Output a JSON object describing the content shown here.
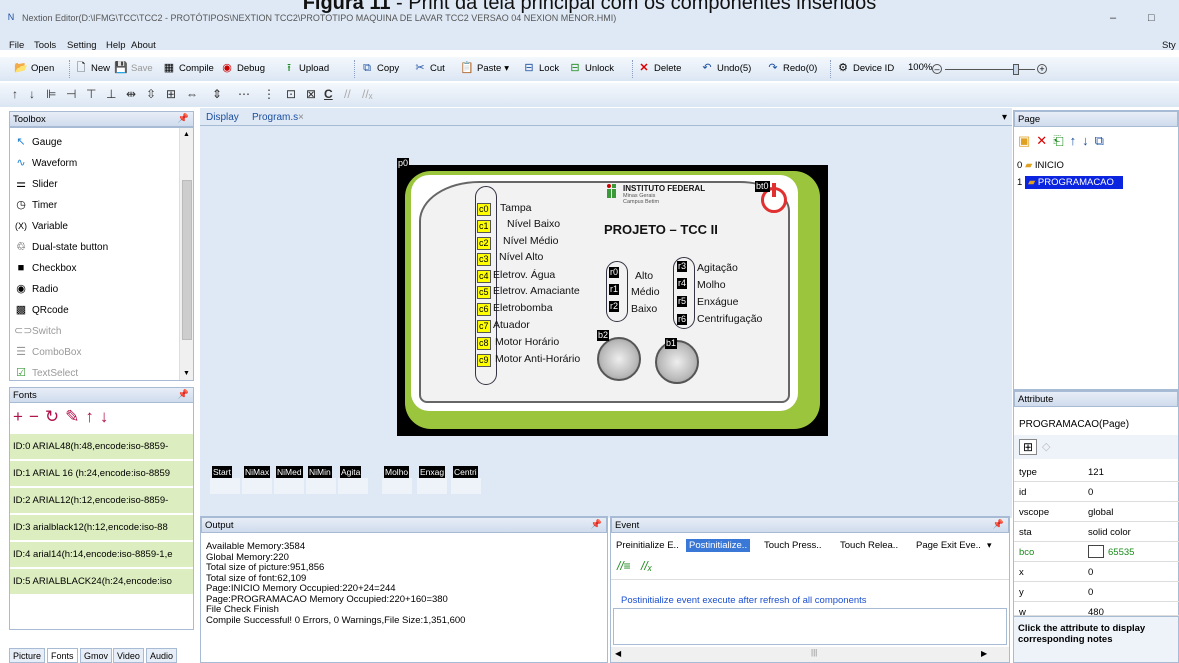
{
  "caption": {
    "prefix": "Figura 11",
    "text": " - Print da tela principal com os componentes inseridos"
  },
  "window": {
    "title": "Nextion Editor(D:\\IFMG\\TCC\\TCC2 - PROTÓTIPOS\\NEXTION TCC2\\PROTOTIPO MAQUINA DE LAVAR TCC2 VERSAO 04 NEXION MENOR.HMI)",
    "minimize": "–",
    "maximize": "□"
  },
  "menu": [
    "File",
    "Tools",
    "Setting",
    "Help",
    "About"
  ],
  "menu_right": "Sty",
  "toolbar": {
    "open": "Open",
    "new": "New",
    "save": "Save",
    "compile": "Compile",
    "debug": "Debug",
    "upload": "Upload",
    "copy": "Copy",
    "cut": "Cut",
    "paste": "Paste",
    "lock": "Lock",
    "unlock": "Unlock",
    "delete": "Delete",
    "undo": "Undo(5)",
    "redo": "Redo(0)",
    "device_id": "Device ID",
    "zoom": "100%"
  },
  "toolbox": {
    "title": "Toolbox",
    "items": [
      "Gauge",
      "Waveform",
      "Slider",
      "Timer",
      "Variable",
      "Dual-state button",
      "Checkbox",
      "Radio",
      "QRcode",
      "Switch",
      "ComboBox",
      "TextSelect"
    ]
  },
  "fonts": {
    "title": "Fonts",
    "rows": [
      "ID:0  ARIAL48(h:48,encode:iso-8859-",
      "ID:1  ARIAL 16 (h:24,encode:iso-8859",
      "ID:2  ARIAL12(h:12,encode:iso-8859-",
      "ID:3  arialblack12(h:12,encode:iso-88",
      "ID:4  arial14(h:14,encode:iso-8859-1,e",
      "ID:5  ARIALBLACK24(h:24,encode:iso"
    ]
  },
  "bottom_tabs": [
    "Picture",
    "Fonts",
    "Gmov",
    "Video",
    "Audio"
  ],
  "doc_tabs": [
    "Display",
    "Program.s"
  ],
  "device": {
    "page_tag": "p0",
    "brand": "INSTITUTO FEDERAL",
    "brand_sub1": "Minas Gerais",
    "brand_sub2": "Campus Betim",
    "project": "PROJETO – TCC II",
    "left_labels": [
      "Tampa",
      "Nível Baixo",
      "Nível Médio",
      "Nível Alto",
      "Eletrov. Água",
      "Eletrov. Amaciante",
      "Eletrobomba",
      "Atuador",
      "Motor Horário",
      "Motor Anti-Horário"
    ],
    "left_tags": [
      "c0",
      "c1",
      "c2",
      "c3",
      "c4",
      "c5",
      "c6",
      "c7",
      "c8",
      "c9"
    ],
    "level_labels": [
      "Alto",
      "Médio",
      "Baixo"
    ],
    "level_tags": [
      "r0",
      "r1",
      "r2"
    ],
    "mode_labels": [
      "Agitação",
      "Molho",
      "Enxágue",
      "Centrifugação"
    ],
    "mode_tags": [
      "r3",
      "r4",
      "r5",
      "r6"
    ],
    "knob_tags": [
      "b2",
      "b1"
    ],
    "power_tag": "bt0"
  },
  "strip": [
    "Start",
    "NiMax",
    "NiMed",
    "NiMin",
    "Agita",
    "Molho",
    "Enxag",
    "Centri"
  ],
  "output": {
    "title": "Output",
    "lines": [
      "Available Memory:3584",
      "Global Memory:220",
      "Total size of picture:951,856",
      "Total size of font:62,109",
      "Page:INICIO Memory Occupied:220+24=244",
      "Page:PROGRAMACAO Memory Occupied:220+160=380",
      "File Check Finish",
      "Compile Successful! 0 Errors, 0 Warnings,File Size:1,351,600"
    ]
  },
  "event": {
    "title": "Event",
    "tabs": [
      "Preinitialize E..",
      "Postinitialize..",
      "Touch Press..",
      "Touch Relea..",
      "Page Exit Eve.."
    ],
    "desc": "Postinitialize event execute after refresh of all components"
  },
  "page": {
    "title": "Page",
    "items": [
      {
        "idx": "0",
        "name": "INICIO"
      },
      {
        "idx": "1",
        "name": "PROGRAMACAO"
      }
    ]
  },
  "attribute": {
    "title": "Attribute",
    "object": "PROGRAMACAO(Page)",
    "rows": [
      {
        "k": "type",
        "v": "121"
      },
      {
        "k": "id",
        "v": "0"
      },
      {
        "k": "vscope",
        "v": "global"
      },
      {
        "k": "sta",
        "v": "solid color"
      },
      {
        "k": "bco",
        "v": "65535"
      },
      {
        "k": "x",
        "v": "0"
      },
      {
        "k": "y",
        "v": "0"
      },
      {
        "k": "w",
        "v": "480"
      }
    ],
    "hint": "Click the attribute to display corresponding notes"
  },
  "colors": {
    "accent": "#9bc53d",
    "selected": "#0a24e0",
    "tag_yellow": "#ffff00",
    "font_row": "#dcedbf",
    "bco_green": "#1a8a1a"
  }
}
